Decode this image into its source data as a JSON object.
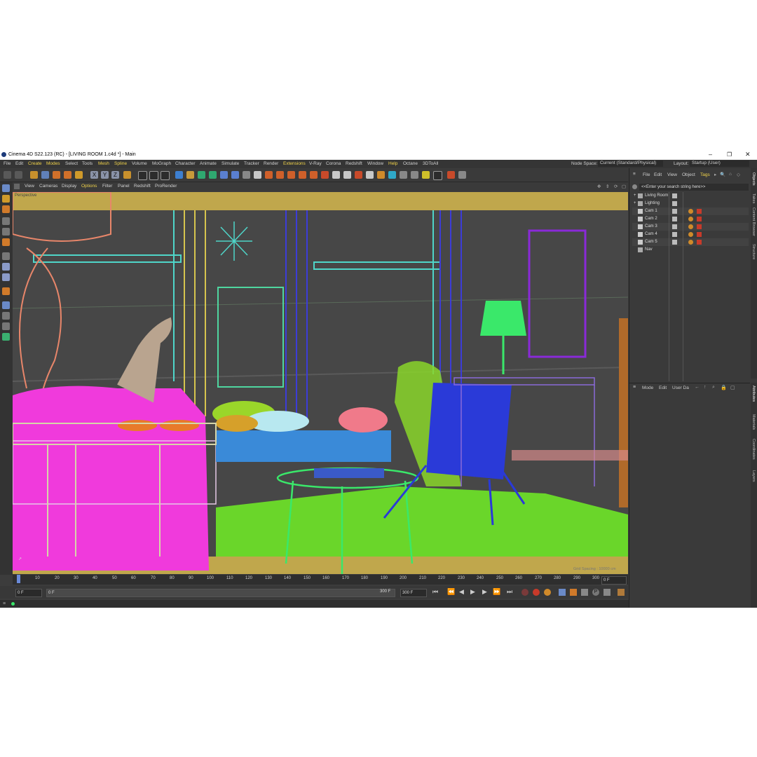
{
  "window": {
    "title": "Cinema 4D S22.123 (RC) - [LIVING ROOM 1.c4d *] - Main",
    "controls": [
      "–",
      "❐",
      "✕"
    ]
  },
  "menu": {
    "items": [
      "File",
      "Edit",
      "Create",
      "Modes",
      "Select",
      "Tools",
      "Mesh",
      "Spline",
      "Volume",
      "MoGraph",
      "Character",
      "Animate",
      "Simulate",
      "Tracker",
      "Render",
      "Extensions",
      "V-Ray",
      "Corona",
      "Redshift",
      "Window",
      "Help",
      "Octane",
      "3DToAll"
    ],
    "node_space_label": "Node Space:",
    "node_space_value": "Current (Standard/Physical)",
    "layout_label": "Layout:",
    "layout_value": "Startup (User)"
  },
  "viewport_menu": {
    "items": [
      "View",
      "Cameras",
      "Display",
      "Options",
      "Filter",
      "Panel",
      "Redshift",
      "ProRender"
    ],
    "camera_label": "Perspective",
    "grid_spacing": "Grid Spacing : 10000 cm"
  },
  "timeline": {
    "ticks": [
      "0",
      "10",
      "20",
      "30",
      "40",
      "50",
      "60",
      "70",
      "80",
      "90",
      "100",
      "110",
      "120",
      "130",
      "140",
      "150",
      "160",
      "170",
      "180",
      "190",
      "200",
      "210",
      "220",
      "230",
      "240",
      "250",
      "260",
      "270",
      "280",
      "290",
      "300"
    ],
    "current_frame_field": "0 F"
  },
  "transport": {
    "start_field": "0 F",
    "min_field": "0 F",
    "end_field": "300 F",
    "max_field": "300 F"
  },
  "object_manager": {
    "menu": [
      "File",
      "Edit",
      "View",
      "Object",
      "Tags"
    ],
    "search_placeholder": "<<Enter your search string here>>",
    "objects": [
      "Living Room",
      "Lighting",
      "Cam 1",
      "Cam 2",
      "Cam 3",
      "Cam 4",
      "Cam 5",
      "Nav"
    ]
  },
  "attribute_manager": {
    "menu": [
      "Mode",
      "Edit",
      "User Da"
    ]
  },
  "side_tabs_top": [
    "Objects",
    "Takes",
    "Content Browser",
    "Structure"
  ],
  "side_tabs_bottom": [
    "Attributes",
    "Materials",
    "Coordinates",
    "Layers"
  ],
  "colors": {
    "panel_bg": "#3c3c3c",
    "viewport_bg": "#474747",
    "accent_yellow": "#f1d34a"
  }
}
